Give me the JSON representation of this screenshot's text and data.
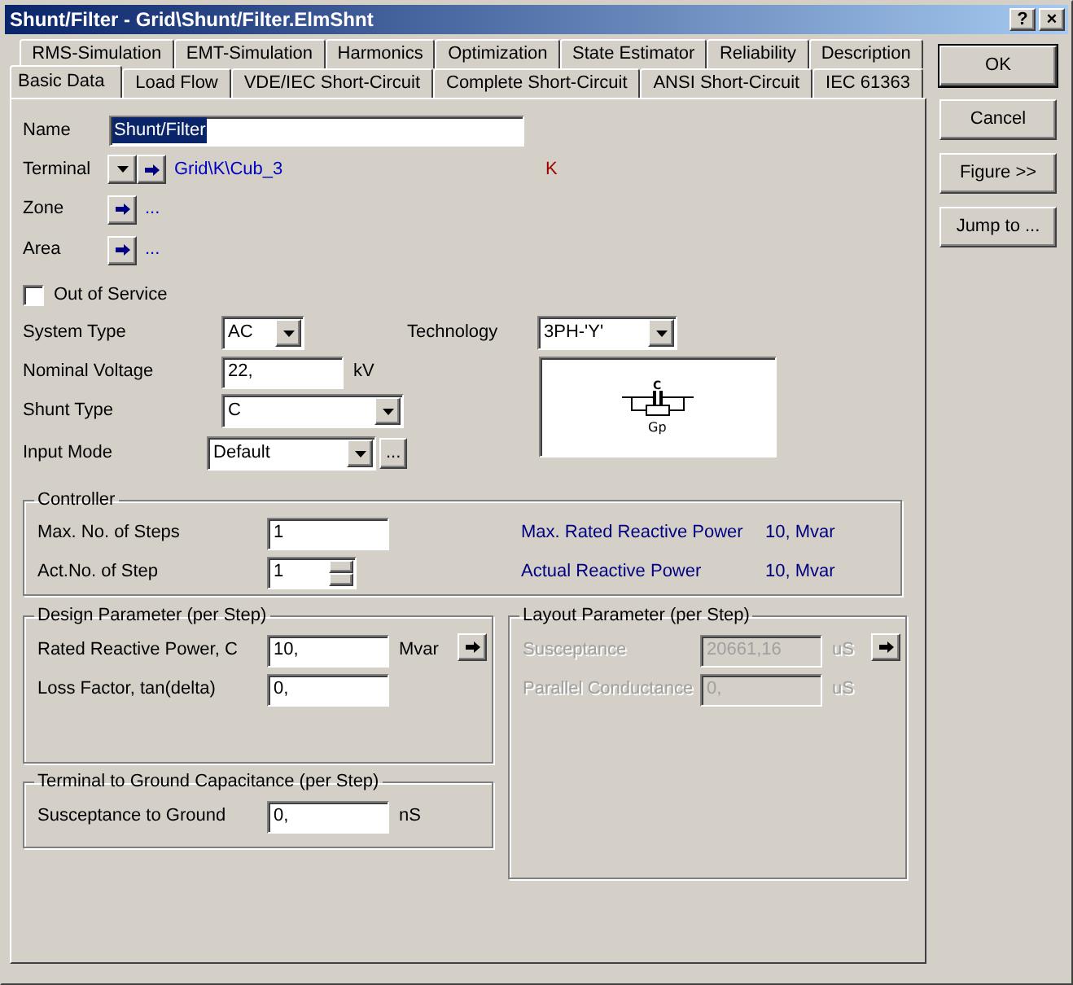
{
  "window": {
    "title": "Shunt/Filter - Grid\\Shunt/Filter.ElmShnt",
    "buttons": [
      {
        "kind": "help",
        "label": "?"
      },
      {
        "kind": "close",
        "label": "×"
      }
    ]
  },
  "tab_rows": [
    [
      {
        "label": "RMS-Simulation",
        "selected": false
      },
      {
        "label": "EMT-Simulation",
        "selected": false
      },
      {
        "label": "Harmonics",
        "selected": false
      },
      {
        "label": "Optimization",
        "selected": false
      },
      {
        "label": "State Estimator",
        "selected": false
      },
      {
        "label": "Reliability",
        "selected": false
      },
      {
        "label": "Description",
        "selected": false
      }
    ],
    [
      {
        "label": "Basic Data",
        "selected": true
      },
      {
        "label": "Load Flow",
        "selected": false
      },
      {
        "label": "VDE/IEC Short-Circuit",
        "selected": false
      },
      {
        "label": "Complete Short-Circuit",
        "selected": false
      },
      {
        "label": "ANSI Short-Circuit",
        "selected": false
      },
      {
        "label": "IEC 61363",
        "selected": false
      }
    ]
  ],
  "basic": {
    "name": {
      "label": "Name",
      "value": "Shunt/Filter"
    },
    "terminal": {
      "label": "Terminal",
      "link": "Grid\\K\\Cub_3",
      "node": "K"
    },
    "zone": {
      "label": "Zone",
      "link": "..."
    },
    "area": {
      "label": "Area",
      "link": "..."
    },
    "out_of_service": {
      "label": "Out of Service",
      "checked": false
    },
    "system_type": {
      "label": "System Type",
      "value": "AC"
    },
    "technology": {
      "label": "Technology",
      "value": "3PH-'Y'"
    },
    "nominal_voltage": {
      "label": "Nominal Voltage",
      "value": "22,",
      "unit": "kV"
    },
    "shunt_type": {
      "label": "Shunt Type",
      "value": "C"
    },
    "input_mode": {
      "label": "Input Mode",
      "value": "Default",
      "button": "..."
    },
    "diagram": {
      "labels": [
        "C",
        "Gp"
      ]
    }
  },
  "controller": {
    "title": "Controller",
    "rows": [
      {
        "kind": "field",
        "label": "Max. No. of Steps",
        "value": "1",
        "info_label": "Max. Rated Reactive Power",
        "info_value": "10, Mvar"
      },
      {
        "kind": "spinner",
        "label": "Act.No. of Step",
        "value": "1",
        "info_label": "Actual Reactive Power",
        "info_value": "10, Mvar"
      }
    ]
  },
  "design": {
    "title": "Design Parameter (per Step)",
    "disabled": false,
    "rows": [
      {
        "label": "Rated Reactive Power, C",
        "value": "10,",
        "unit": "Mvar"
      },
      {
        "label": "Loss Factor, tan(delta)",
        "value": "0,"
      }
    ]
  },
  "ground": {
    "title": "Terminal to Ground Capacitance (per Step)",
    "rows": [
      {
        "label": "Susceptance to Ground",
        "value": "0,",
        "unit": "nS"
      }
    ]
  },
  "layout": {
    "title": "Layout Parameter (per Step)",
    "disabled": true,
    "rows": [
      {
        "label": "Susceptance",
        "value": "20661,16",
        "unit": "uS"
      },
      {
        "label": "Parallel Conductance",
        "value": "0,",
        "unit": "uS"
      }
    ]
  },
  "side_buttons": [
    {
      "label": "OK",
      "default": true
    },
    {
      "label": "Cancel",
      "default": false
    },
    {
      "label": "Figure >>",
      "default": false
    },
    {
      "label": "Jump to ...",
      "default": false
    }
  ]
}
